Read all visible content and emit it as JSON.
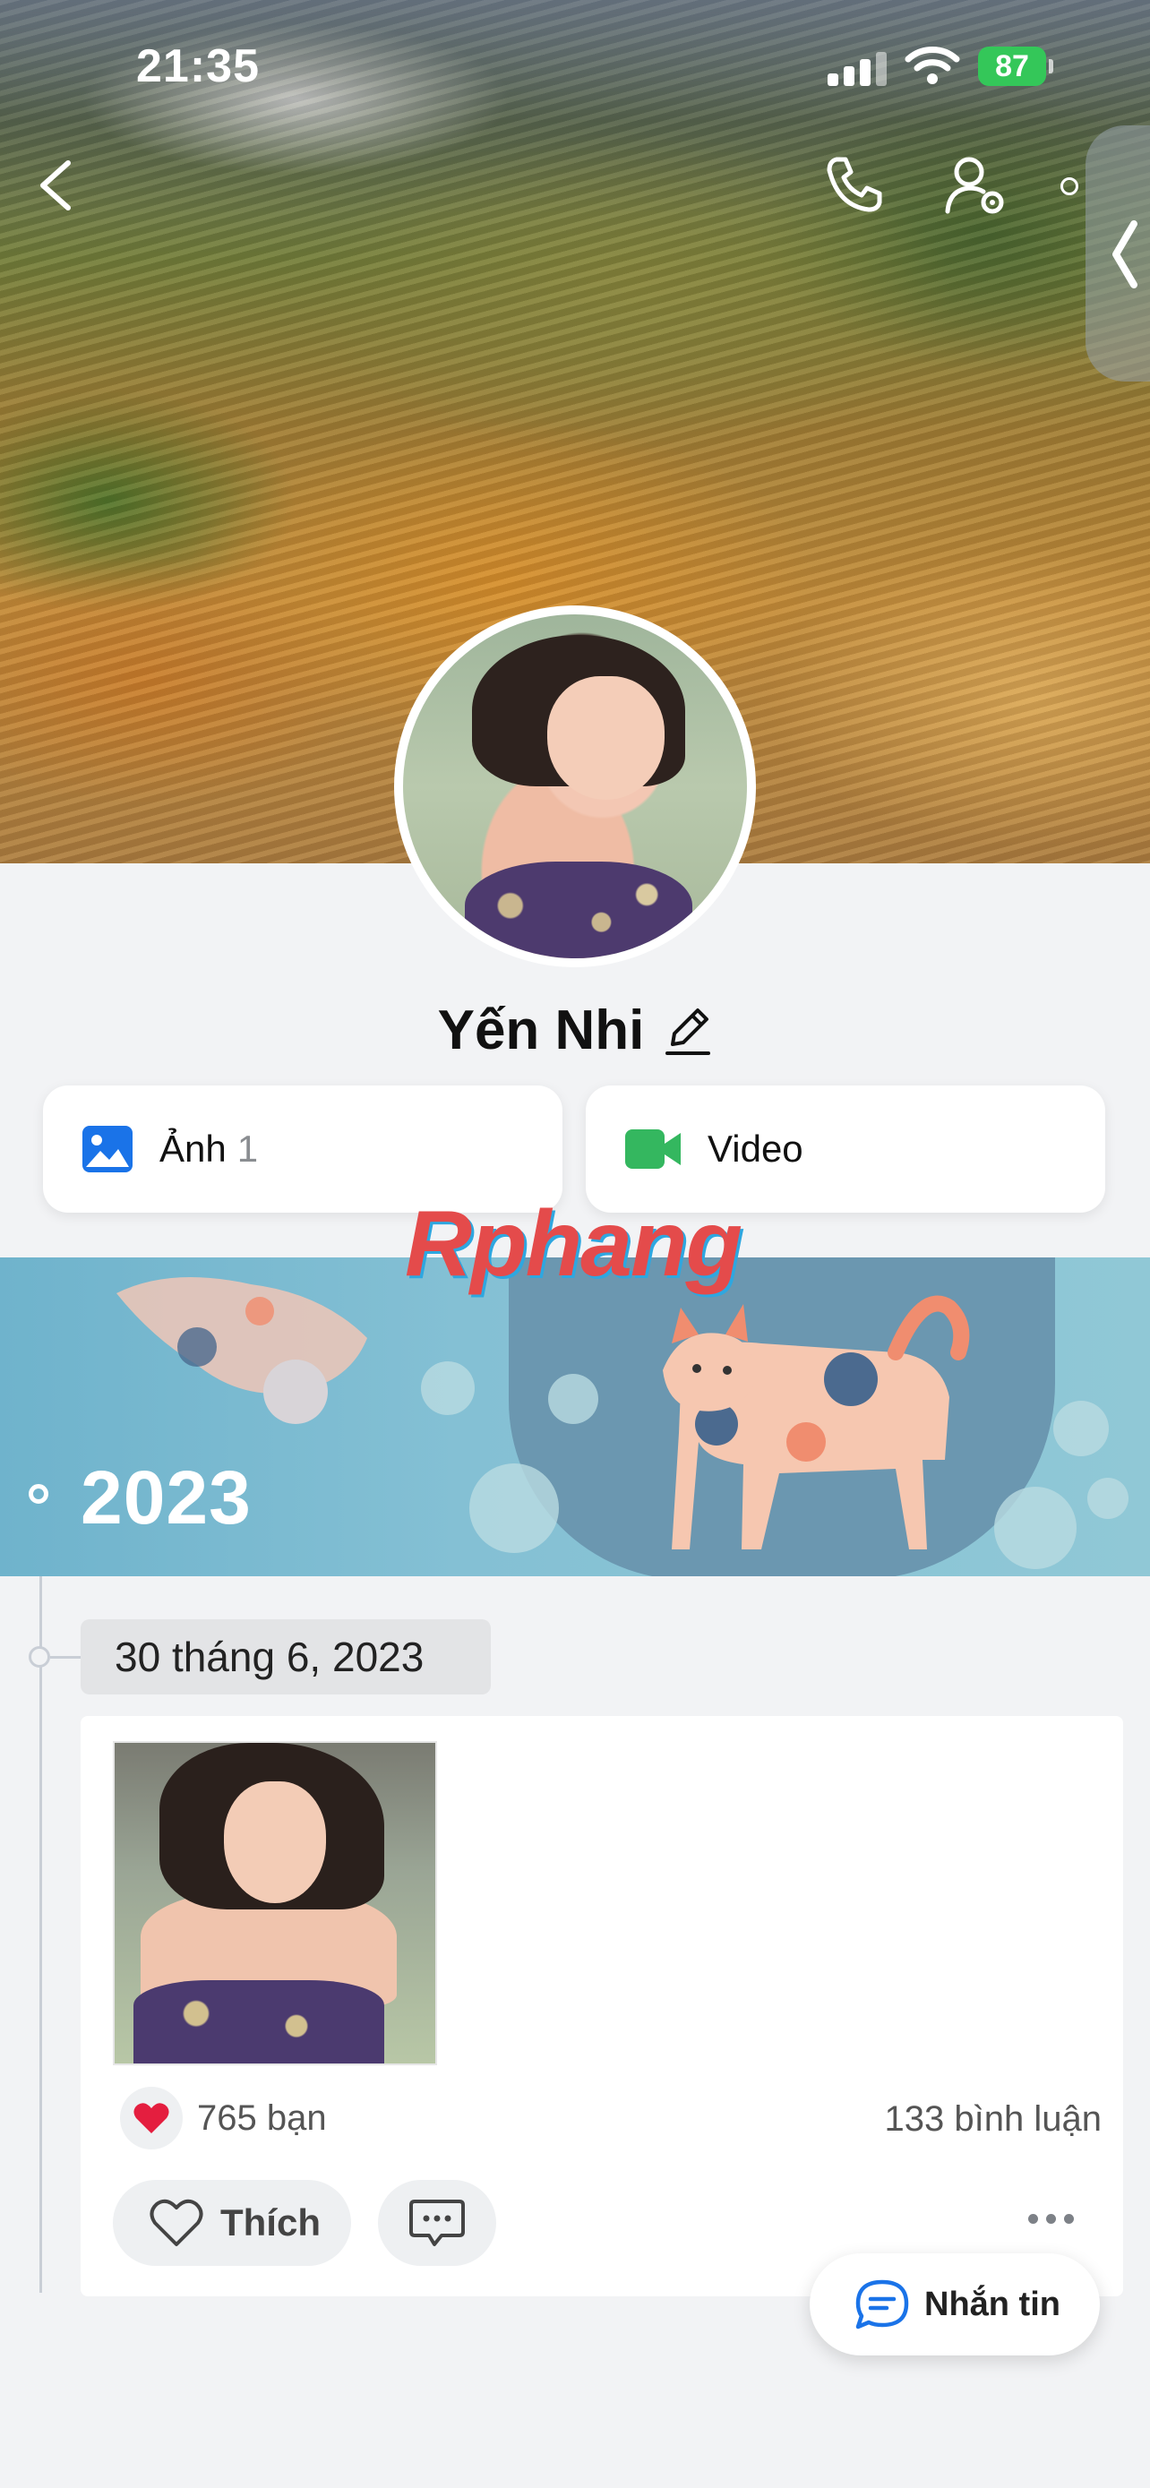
{
  "status_bar": {
    "time": "21:35",
    "battery": "87"
  },
  "nav": {
    "back_icon": "chevron-left-icon",
    "call_icon": "phone-icon",
    "settings_icon": "user-settings-icon"
  },
  "profile": {
    "name": "Yến Nhi",
    "edit_icon": "pencil-icon"
  },
  "media_tabs": [
    {
      "label": "Ảnh",
      "count": "1",
      "icon": "image-icon",
      "color": "#1a73e8"
    },
    {
      "label": "Video",
      "count": "",
      "icon": "video-camera-icon",
      "color": "#34b75f"
    }
  ],
  "watermark": "Rphang",
  "timeline": {
    "year": "2023",
    "date": "30 tháng 6, 2023"
  },
  "post": {
    "reactions_count": "765 bạn",
    "reaction_icon": "heart-icon",
    "comments_count": "133 bình luận",
    "like_label": "Thích"
  },
  "message_button": {
    "label": "Nhắn tin",
    "accent": "#1a73e8"
  }
}
